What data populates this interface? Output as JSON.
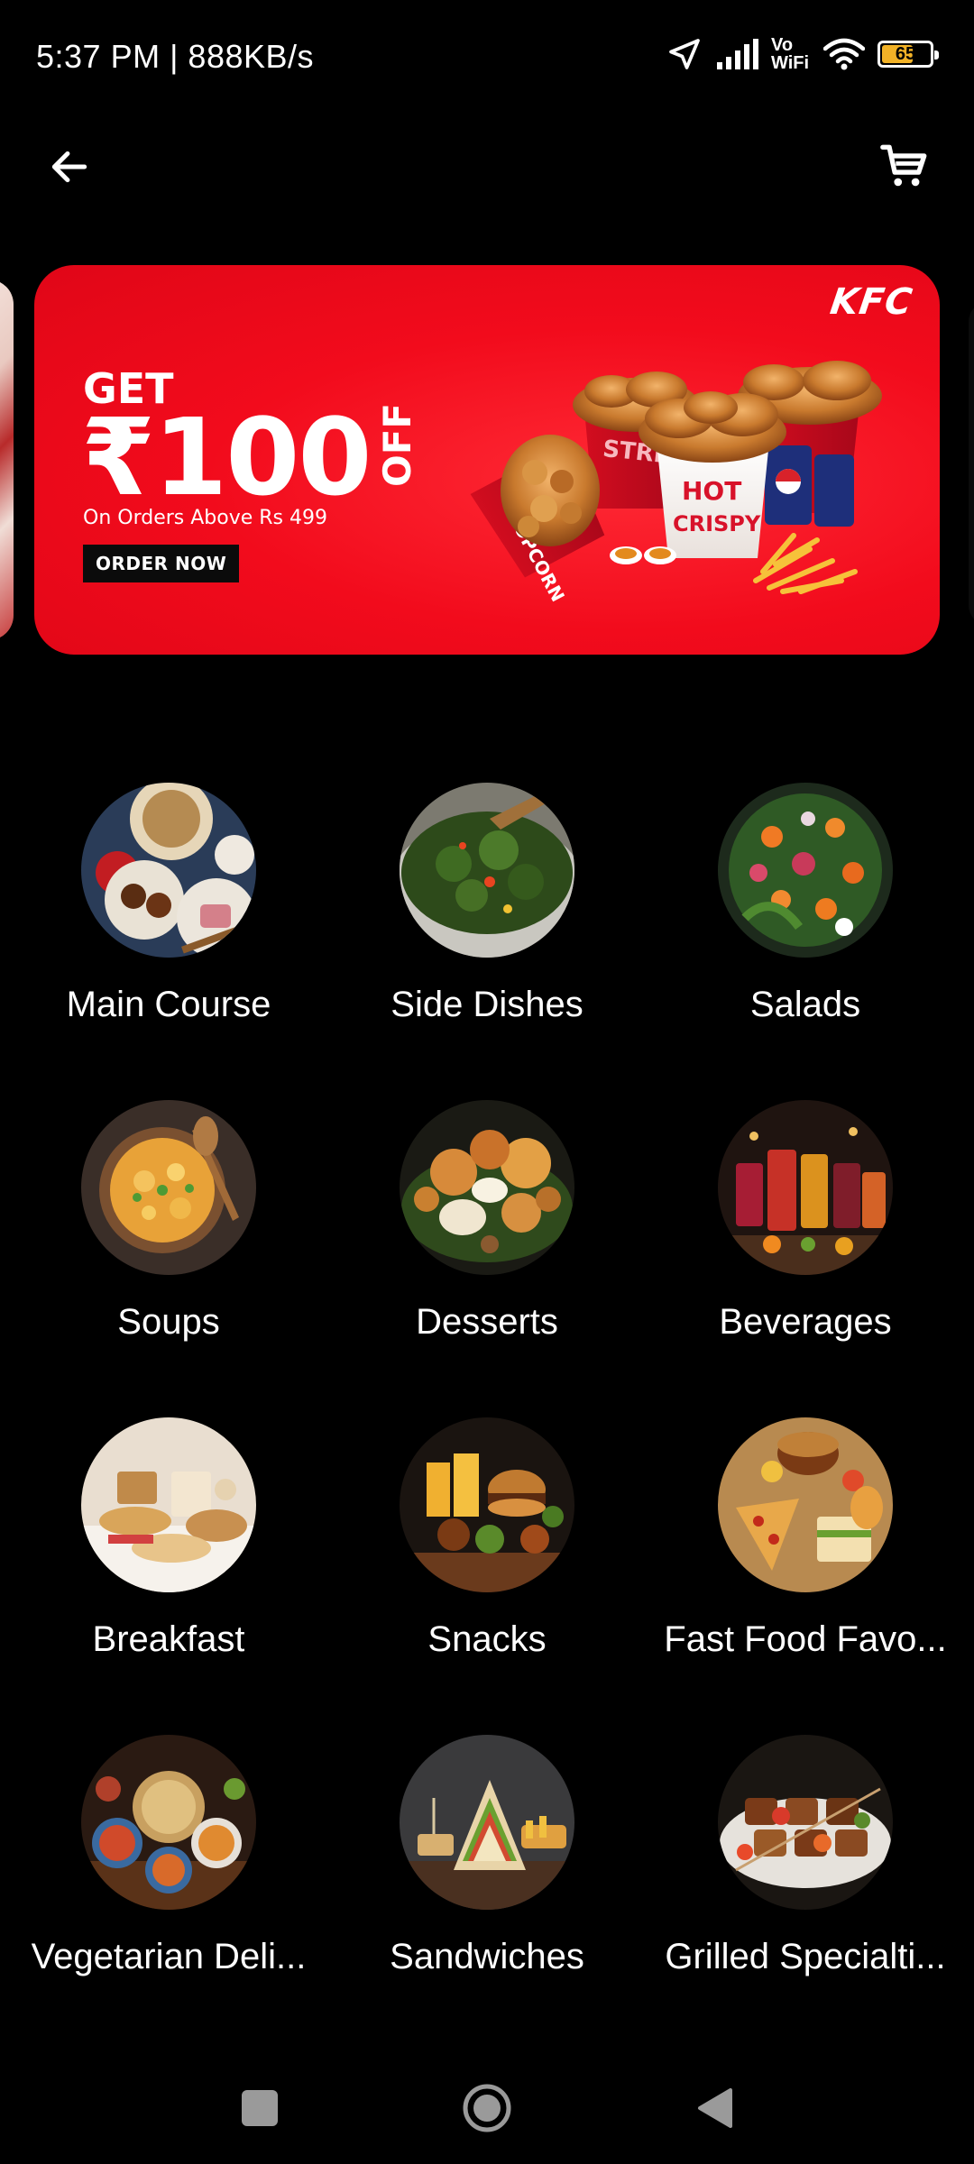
{
  "status_bar": {
    "time_speed": "5:37 PM | 888KB/s",
    "vowifi_top": "Vo",
    "vowifi_bottom": "WiFi",
    "battery_level": "65",
    "battery_fraction": 0.65,
    "icons": [
      "location-arrow-icon",
      "signal-icon",
      "vowifi-icon",
      "wifi-icon",
      "battery-icon"
    ]
  },
  "app_bar": {
    "back_icon": "arrow-left-icon",
    "cart_icon": "shopping-cart-icon"
  },
  "banner": {
    "brand": "KFC",
    "headline_get": "GET",
    "headline_amount": "₹100",
    "headline_off": "OFF",
    "subtext": "On Orders Above Rs 499",
    "cta_label": "ORDER NOW",
    "bucket_labels": [
      "STRIPS",
      "HOT & CRISPY",
      "POPCORN"
    ],
    "colors": {
      "background": "#f20b1c",
      "text": "#ffffff",
      "cta_background": "#0b0b0b"
    }
  },
  "categories": [
    {
      "label": "Main Course"
    },
    {
      "label": "Side Dishes"
    },
    {
      "label": "Salads"
    },
    {
      "label": "Soups"
    },
    {
      "label": "Desserts"
    },
    {
      "label": "Beverages"
    },
    {
      "label": "Breakfast"
    },
    {
      "label": "Snacks"
    },
    {
      "label": "Fast Food Favo..."
    },
    {
      "label": "Vegetarian Deli..."
    },
    {
      "label": "Sandwiches"
    },
    {
      "label": "Grilled Specialti..."
    }
  ],
  "nav_bar": {
    "icons": [
      "recents-square-icon",
      "home-circle-icon",
      "back-triangle-icon"
    ]
  }
}
